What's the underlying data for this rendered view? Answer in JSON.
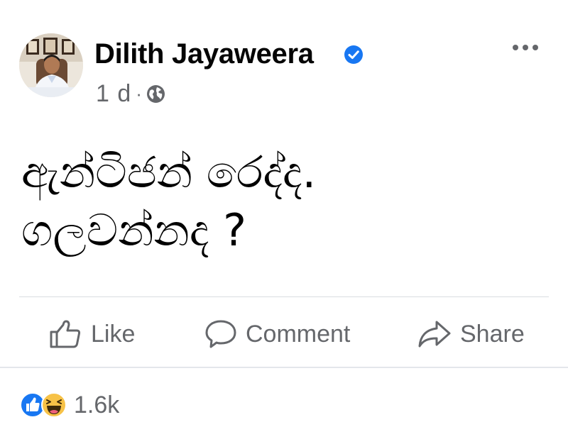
{
  "post": {
    "author": "Dilith Jayaweera",
    "time": "1 d",
    "separator": "·",
    "privacy_icon": "globe-icon",
    "verified_icon": "verified-badge-icon",
    "more_icon": "more-options-icon",
    "text_lines": [
      "ඇන්ටිජන් රෙද්ද.",
      "ගලවන්නද ?"
    ]
  },
  "actions": {
    "like_label": "Like",
    "like_icon": "thumbs-up-icon",
    "comment_label": "Comment",
    "comment_icon": "comment-bubble-icon",
    "share_label": "Share",
    "share_icon": "share-arrow-icon"
  },
  "reactions": {
    "icons": [
      "like-reaction-icon",
      "haha-reaction-icon"
    ],
    "count": "1.6k"
  },
  "colors": {
    "verified_blue": "#1877f2",
    "secondary_text": "#65676b",
    "haha_yellow": "#f7c247",
    "divider": "#dadde1"
  }
}
